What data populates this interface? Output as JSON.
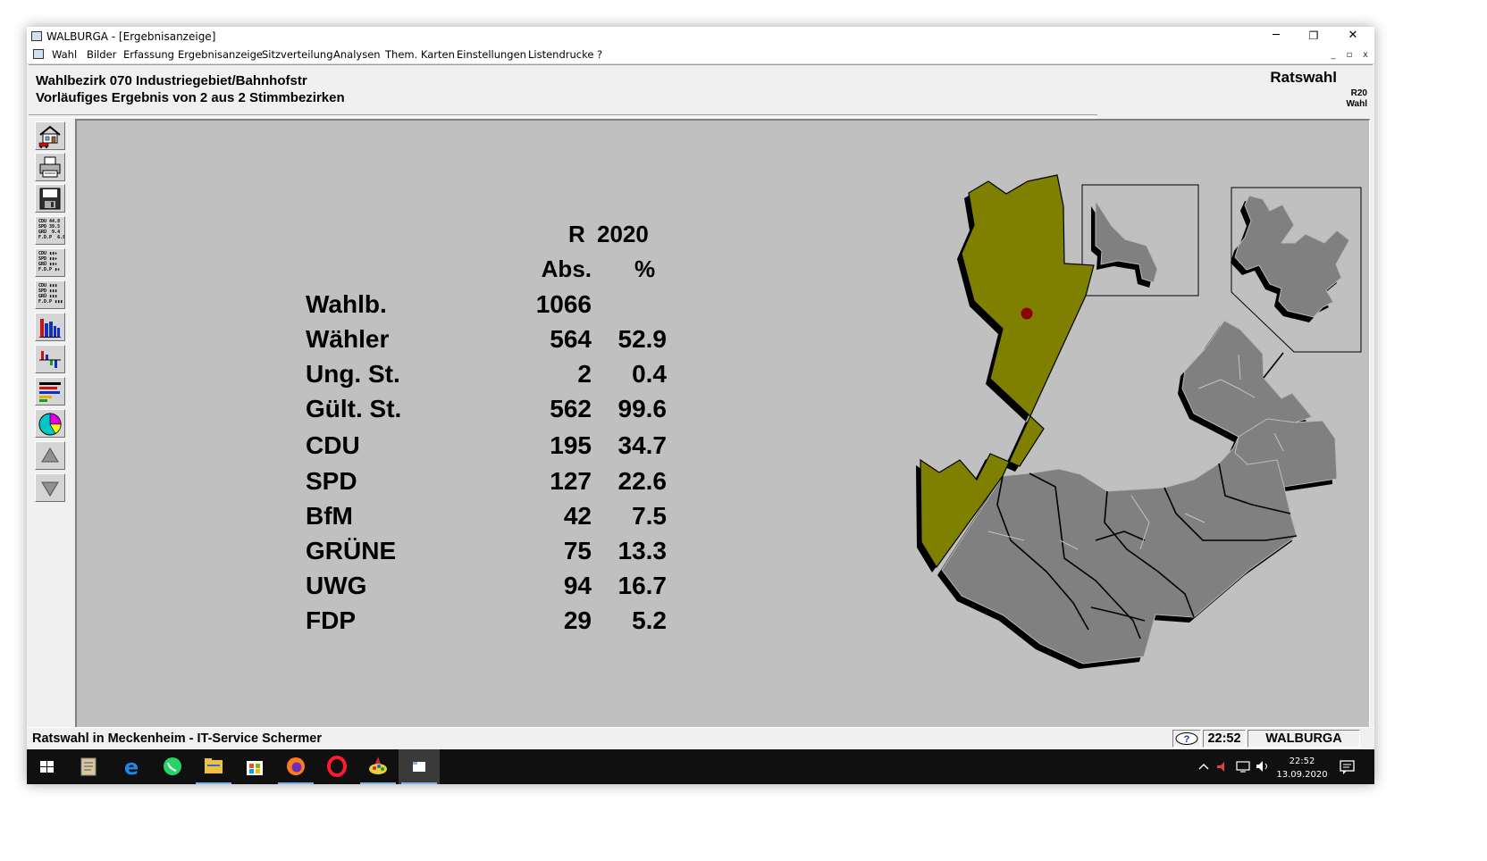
{
  "window": {
    "title": "WALBURGA - [Ergebnisanzeige]",
    "controls": {
      "minimize": "─",
      "maximize": "❐",
      "close": "✕"
    }
  },
  "menu": {
    "items": [
      "Wahl",
      "Bilder",
      "Erfassung",
      "Ergebnisanzeige",
      "Sitzverteilung",
      "Analysen",
      "Them. Karten",
      "Einstellungen",
      "Listendrucke",
      "?"
    ],
    "mdi": {
      "minimize": "_",
      "restore": "▫",
      "close": "x"
    }
  },
  "header": {
    "line1": "Wahlbezirk 070 Industriegebiet/Bahnhofstr",
    "line2": "Vorläufiges Ergebnis von 2 aus 2 Stimmbezirken",
    "election": "Ratswahl",
    "code": "R20",
    "code_sub": "Wahl"
  },
  "toolbar": {
    "icons": [
      "house-icon",
      "printer-icon",
      "floppy-disk-icon",
      "results-table-icon",
      "tally-table-icon",
      "seat-table-icon",
      "bar-chart-icon",
      "diff-chart-icon",
      "horizontal-bar-icon",
      "pie-chart-icon",
      "arrow-up-icon",
      "arrow-down-icon"
    ],
    "mini_table_values": "CDU 44.8\nSPD 39.5\nGRÜ  9.4\nF.D.P  6.8",
    "mini_table_tally": "CDU ▮▮+\nSPD ▮▮+\nGRÜ ▮▮+\nF.D.P ▮+",
    "mini_table_seats": "CDU ▮▮▮\nSPD ▮▮▮\nGRÜ ▮▮▮\nF.D.P ▮▮▮"
  },
  "results": {
    "election_label": "R",
    "year": "2020",
    "col_abs": "Abs.",
    "col_pct": "%",
    "rows": [
      {
        "label": "Wahlb.",
        "abs": "1066",
        "pct": ""
      },
      {
        "label": "Wähler",
        "abs": "564",
        "pct": "52.9"
      },
      {
        "label": "Ung. St.",
        "abs": "2",
        "pct": "0.4"
      },
      {
        "label": "Gült. St.",
        "abs": "562",
        "pct": "99.6"
      },
      {
        "label": "CDU",
        "abs": "195",
        "pct": "34.7"
      },
      {
        "label": "SPD",
        "abs": "127",
        "pct": "22.6"
      },
      {
        "label": "BfM",
        "abs": "42",
        "pct": "7.5"
      },
      {
        "label": "GRÜNE",
        "abs": "75",
        "pct": "13.3"
      },
      {
        "label": "UWG",
        "abs": "94",
        "pct": "16.7"
      },
      {
        "label": "FDP",
        "abs": "29",
        "pct": "5.2"
      }
    ]
  },
  "map": {
    "selected_color": "#808000",
    "district_color": "#808080",
    "marker_color": "#8b0000"
  },
  "status": {
    "text": "Ratswahl in Meckenheim - IT-Service Schermer",
    "help_icon": "help-icon",
    "time": "22:52",
    "app": "WALBURGA"
  },
  "taskbar": {
    "apps": [
      "windows-start-icon",
      "notepad-icon",
      "edge-icon",
      "whatsapp-icon",
      "explorer-icon",
      "store-icon",
      "firefox-icon",
      "opera-icon",
      "paint-icon",
      "walburga-app-icon"
    ],
    "tray": "^ ◀ ▭ ◁)",
    "clock_time": "22:52",
    "clock_date": "13.09.2020",
    "notification_icon": "notification-icon"
  }
}
